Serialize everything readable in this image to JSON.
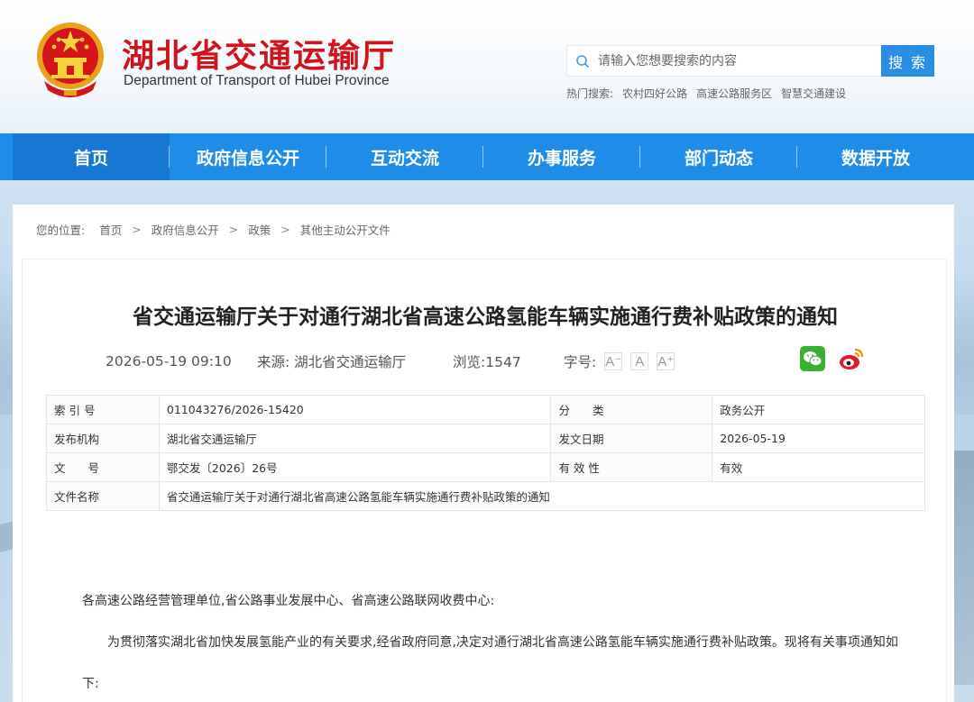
{
  "header": {
    "site_title": "湖北省交通运输厅",
    "site_subtitle": "Department of Transport of Hubei Province",
    "search": {
      "placeholder": "请输入您想要搜索的内容",
      "button_label": "搜 索"
    },
    "hot_search": {
      "label": "热门搜索:",
      "items": [
        "农村四好公路",
        "高速公路服务区",
        "智慧交通建设"
      ]
    }
  },
  "nav": {
    "items": [
      "首页",
      "政府信息公开",
      "互动交流",
      "办事服务",
      "部门动态",
      "数据开放"
    ]
  },
  "breadcrumb": {
    "label": "您的位置:",
    "items": [
      "首页",
      "政府信息公开",
      "政策",
      "其他主动公开文件"
    ]
  },
  "article": {
    "title": "省交通运输厅关于对通行湖北省高速公路氢能车辆实施通行费补贴政策的通知",
    "date": "2026-05-19 09:10",
    "source_label": "来源:",
    "source": "湖北省交通运输厅",
    "views_label": "浏览:",
    "views": "1547",
    "font_size_label": "字号:",
    "font_buttons": [
      "A⁻",
      "A",
      "A⁺"
    ]
  },
  "info_table": {
    "rows": [
      [
        "索 引 号",
        "011043276/2026-15420",
        "分　　类",
        "政务公开"
      ],
      [
        "发布机构",
        "湖北省交通运输厅",
        "发文日期",
        "2026-05-19"
      ],
      [
        "文　　号",
        "鄂交发〔2026〕26号",
        "有 效 性",
        "有效"
      ]
    ],
    "file_name_label": "文件名称",
    "file_name": "省交通运输厅关于对通行湖北省高速公路氢能车辆实施通行费补贴政策的通知"
  },
  "body": {
    "salutation": "各高速公路经营管理单位,省公路事业发展中心、省高速公路联网收费中心:",
    "paragraph1": "为贯彻落实湖北省加快发展氢能产业的有关要求,经省政府同意,决定对通行湖北省高速公路氢能车辆实施通行费补贴政策。现将有关事项通知如下:"
  },
  "colors": {
    "nav_bg": "#1f8de8",
    "title_red": "#d0141c",
    "search_btn": "#2a8de6"
  }
}
